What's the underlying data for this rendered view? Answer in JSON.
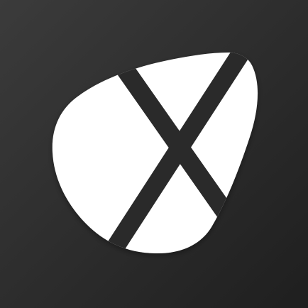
{
  "icon": {
    "name": "pebble-x-logo-icon",
    "shape": "rounded pebble with X cut-out",
    "colors": {
      "background_top": "#3b3b3b",
      "background_bottom": "#1f1f1f",
      "logo": "#ffffff",
      "cut": "#2b2b2b"
    }
  }
}
